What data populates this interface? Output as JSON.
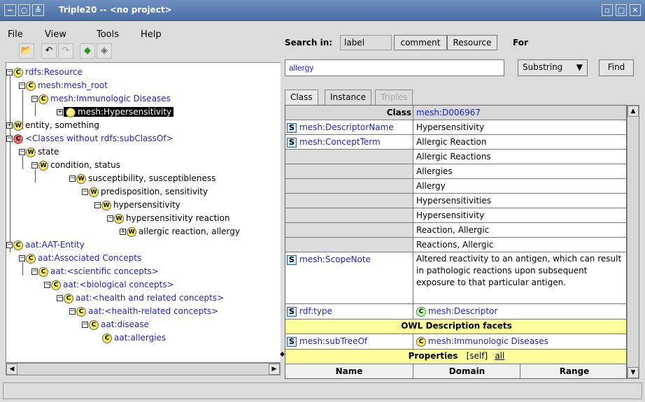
{
  "window": {
    "title": "Triple20 -- <no project>"
  },
  "menu": {
    "file": "File",
    "view": "View",
    "tools": "Tools",
    "help": "Help"
  },
  "search": {
    "label": "Search in:",
    "in_label": "label",
    "in_comment": "comment",
    "in_resource": "Resource",
    "for_label": "For",
    "query": "allergy",
    "mode": "Substring",
    "find_button": "Find"
  },
  "tabs": {
    "class": "Class",
    "instance": "Instance",
    "triples": "Triples"
  },
  "tree": {
    "n1": "rdfs:Resource",
    "n2": "mesh:mesh_root",
    "n3": "mesh:Immunologic Diseases",
    "n4": "mesh:Hypersensitivity",
    "n5": "entity, something",
    "n6": "<Classes without rdfs:subClassOf>",
    "n7": "state",
    "n8": "condition, status",
    "n9": "susceptibility, susceptibleness",
    "n10": "predisposition, sensitivity",
    "n11": "hypersensitivity",
    "n12": "hypersensitivity reaction",
    "n13": "allergic reaction, allergy",
    "n14": "aat:AAT-Entity",
    "n15": "aat:Associated Concepts",
    "n16": "aat:<scientific concepts>",
    "n17": "aat:<biological concepts>",
    "n18": "aat:<health and related  concepts>",
    "n19": "aat:<health-related  concepts>",
    "n20": "aat:disease",
    "n21": "aat:allergies"
  },
  "grid": {
    "class_label": "Class",
    "class_value": "mesh:D006967",
    "descriptor_name_prop": "mesh:DescriptorName",
    "descriptor_name_val": "Hypersensitivity",
    "concept_term_prop": "mesh:ConceptTerm",
    "terms": [
      "Allergic Reaction",
      "Allergic Reactions",
      "Allergies",
      "Allergy",
      "Hypersensitivities",
      "Hypersensitivity",
      "Reaction, Allergic",
      "Reactions, Allergic"
    ],
    "scope_note_prop": "mesh:ScopeNote",
    "scope_note_val": "Altered reactivity to an antigen, which can result in pathologic reactions upon subsequent exposure to that particular antigen.",
    "type_prop": "rdf:type",
    "type_val": "mesh:Descriptor",
    "owl_header": "OWL Description facets",
    "subtree_prop": "mesh:subTreeOf",
    "subtree_val": "mesh:Immunologic Diseases",
    "properties_header": "Properties",
    "self_link": "[self]",
    "all_link": "all",
    "col_name": "Name",
    "col_domain": "Domain",
    "col_range": "Range"
  },
  "icons": {
    "s": "S",
    "c": "C",
    "w": "W"
  }
}
